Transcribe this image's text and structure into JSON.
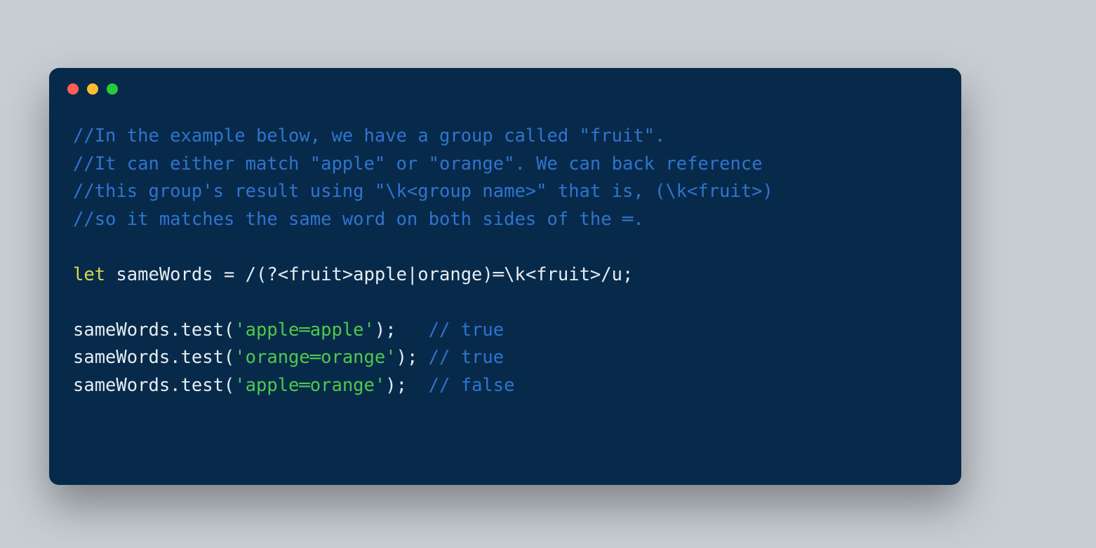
{
  "colors": {
    "page_bg": "#c7cdd2",
    "card_bg": "#082a4a",
    "dot_red": "#ff5f56",
    "dot_yellow": "#ffbd2e",
    "dot_green": "#27c93f",
    "comment": "#2f74d0",
    "keyword": "#d6d94e",
    "plain": "#e6edf3",
    "string": "#4ec94e"
  },
  "traffic_lights": {
    "red_name": "close-dot",
    "yellow_name": "minimize-dot",
    "green_name": "zoom-dot"
  },
  "code": {
    "comment1": "//In the example below, we have a group called \"fruit\".",
    "comment2": "//It can either match \"apple\" or \"orange\". We can back reference",
    "comment3": "//this group's result using \"\\k<group name>\" that is, (\\k<fruit>)",
    "comment4": "//so it matches the same word on both sides of the ═.",
    "blank": "",
    "decl": {
      "let": "let",
      "name": " sameWords ",
      "rest": "= /(?<fruit>apple|orange)═\\k<fruit>/u;"
    },
    "calls": [
      {
        "pre": "sameWords.test(",
        "str": "'apple═apple'",
        "post": ");",
        "pad": "   ",
        "cm": "// true"
      },
      {
        "pre": "sameWords.test(",
        "str": "'orange═orange'",
        "post": ");",
        "pad": " ",
        "cm": "// true"
      },
      {
        "pre": "sameWords.test(",
        "str": "'apple═orange'",
        "post": ");",
        "pad": "  ",
        "cm": "// false"
      }
    ]
  }
}
